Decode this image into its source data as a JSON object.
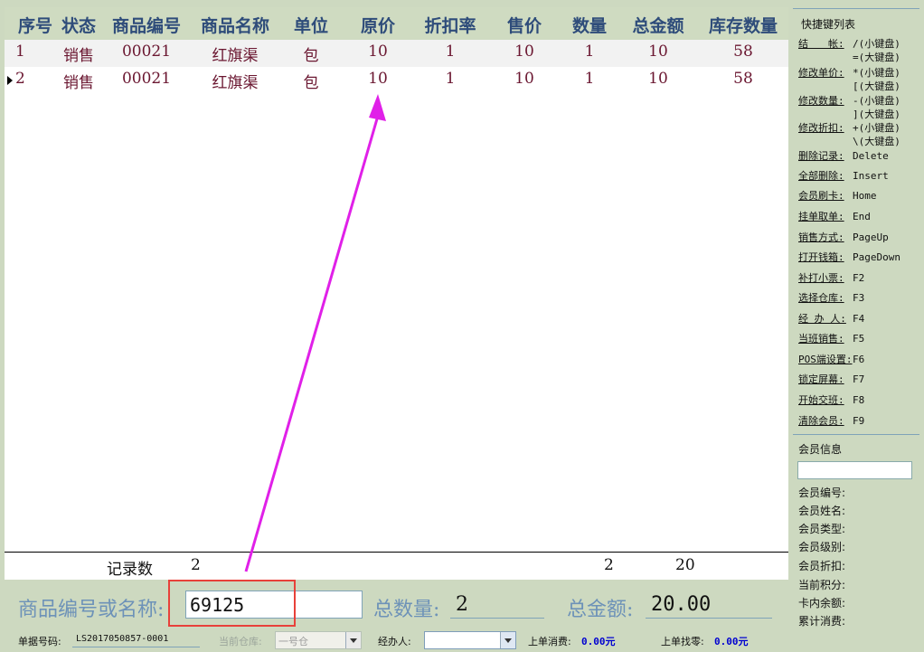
{
  "columns": [
    "序号",
    "状态",
    "商品编号",
    "商品名称",
    "单位",
    "原价",
    "折扣率",
    "售价",
    "数量",
    "总金额",
    "库存数量"
  ],
  "rows": [
    [
      "1",
      "销售",
      "00021",
      "红旗渠",
      "包",
      "10",
      "1",
      "10",
      "1",
      "10",
      "58"
    ],
    [
      "2",
      "销售",
      "00021",
      "红旗渠",
      "包",
      "10",
      "1",
      "10",
      "1",
      "10",
      "58"
    ]
  ],
  "footer": {
    "label": "记录数",
    "count": "2",
    "qty": "2",
    "total": "20"
  },
  "shortcuts": {
    "title": "快捷键列表",
    "items": [
      {
        "label": "结　　帐:",
        "key": "/(小键盘)"
      },
      {
        "label": "",
        "key": "=(大键盘)"
      },
      {
        "label": "修改单价:",
        "key": "*(小键盘)"
      },
      {
        "label": "",
        "key": "[(大键盘)"
      },
      {
        "label": "修改数量:",
        "key": "-(小键盘)"
      },
      {
        "label": "",
        "key": "](大键盘)"
      },
      {
        "label": "修改折扣:",
        "key": "+(小键盘)"
      },
      {
        "label": "",
        "key": "\\(大键盘)"
      },
      {
        "label": "删除记录:",
        "key": "Delete"
      },
      {
        "label": "全部删除:",
        "key": "Insert"
      },
      {
        "label": "会员刷卡:",
        "key": "Home"
      },
      {
        "label": "挂单取单:",
        "key": "End"
      },
      {
        "label": "销售方式:",
        "key": "PageUp"
      },
      {
        "label": "打开钱箱:",
        "key": "PageDown"
      },
      {
        "label": "补打小票:",
        "key": "F2"
      },
      {
        "label": "选择仓库:",
        "key": "F3"
      },
      {
        "label": "经 办 人:",
        "key": "F4"
      },
      {
        "label": "当班销售:",
        "key": "F5"
      },
      {
        "label": "POS端设置:",
        "key": "F6"
      },
      {
        "label": "锁定屏幕:",
        "key": "F7"
      },
      {
        "label": "开始交班:",
        "key": "F8"
      },
      {
        "label": "清除会员:",
        "key": "F9"
      }
    ]
  },
  "member": {
    "title": "会员信息",
    "fields": [
      "会员编号:",
      "会员姓名:",
      "会员类型:",
      "会员级别:",
      "会员折扣:",
      "当前积分:",
      "卡内余额:",
      "累计消费:"
    ]
  },
  "entry": {
    "label": "商品编号或名称:",
    "value": "69125",
    "qty_label": "总数量:",
    "qty_value": "2",
    "total_label": "总金额:",
    "total_value": "20.00"
  },
  "status": {
    "doc_label": "单据号码:",
    "doc_value": "LS2017050857-0001",
    "warehouse_label": "当前仓库:",
    "warehouse_value": "一号仓",
    "handler_label": "经办人:",
    "handler_value": "",
    "last_spend_label": "上单消费:",
    "last_spend_value": "0.00元",
    "last_change_label": "上单找零:",
    "last_change_value": "0.00元"
  },
  "colors": {
    "highlight_box": "#e8413a",
    "arrow": "#e020e8",
    "header_text": "#2e4c7a",
    "row_text": "#6a1630"
  }
}
